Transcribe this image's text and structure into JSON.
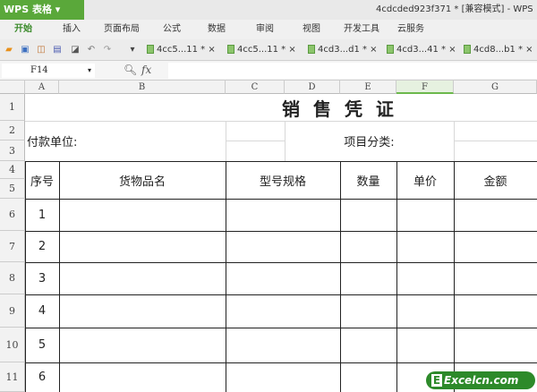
{
  "app": {
    "name": "WPS 表格",
    "doc_title": "4cdcded923f371 * [兼容模式] - WPS"
  },
  "menu": [
    "开始",
    "插入",
    "页面布局",
    "公式",
    "数据",
    "审阅",
    "视图",
    "开发工具",
    "云服务"
  ],
  "tabs": [
    "4cc5...11 *",
    "4cc5...11 *",
    "4cd3...d1 *",
    "4cd3...41 *",
    "4cd8...b1 *"
  ],
  "formula": {
    "cell_ref": "F14",
    "fx": "fx",
    "value": ""
  },
  "columns": [
    "A",
    "B",
    "C",
    "D",
    "E",
    "F",
    "G"
  ],
  "rows": [
    "1",
    "2",
    "3",
    "4",
    "5",
    "6",
    "7",
    "8",
    "9",
    "10",
    "11"
  ],
  "sheet": {
    "title": "销 售 凭 证",
    "payer_label": "付款单位:",
    "category_label": "项目分类:",
    "headers": [
      "序号",
      "货物品名",
      "型号规格",
      "数量",
      "单价",
      "金额"
    ],
    "serials": [
      "1",
      "2",
      "3",
      "4",
      "5",
      "6"
    ]
  },
  "watermark": "Excelcn.com"
}
